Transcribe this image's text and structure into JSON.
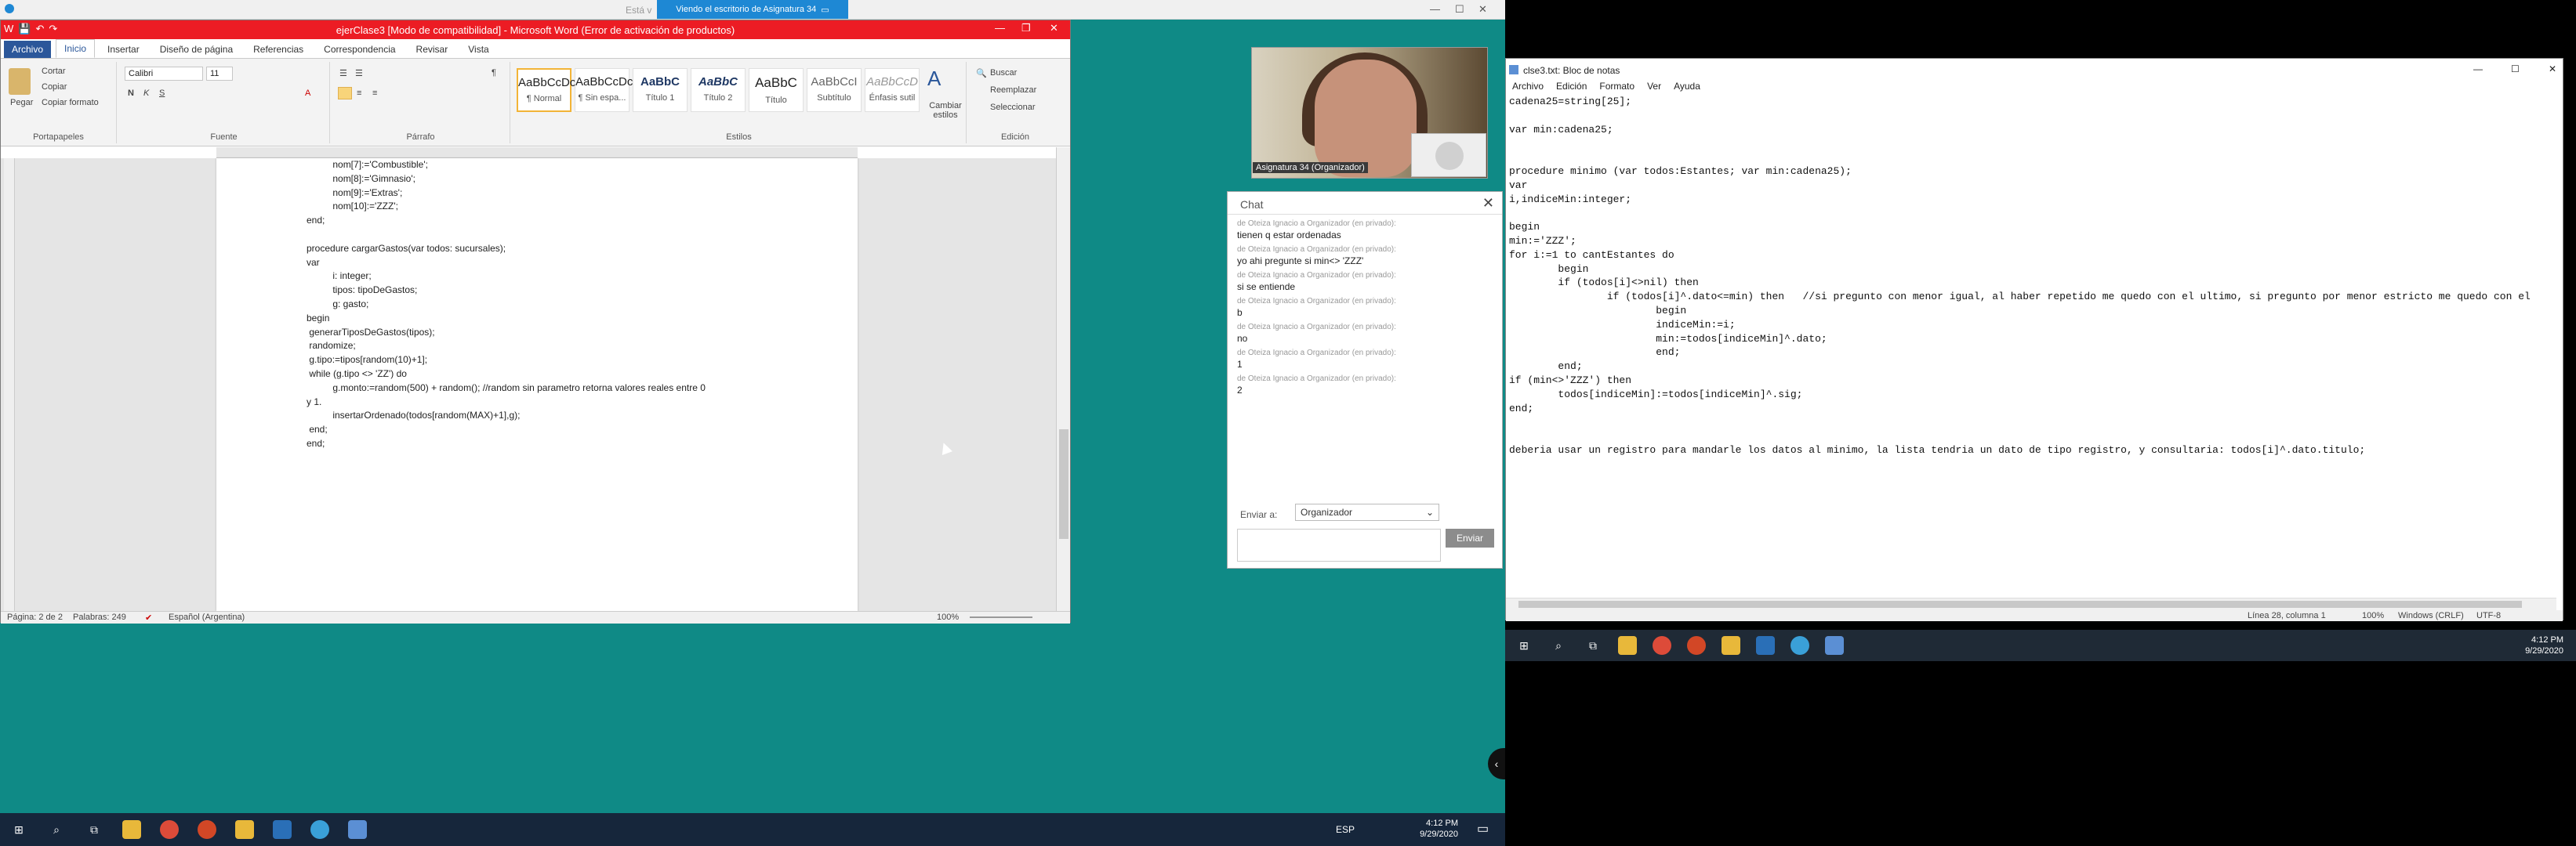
{
  "host": {
    "title_partial": "Está v",
    "share_banner": "Viendo el escritorio de Asignatura 34"
  },
  "word": {
    "title": "ejerClase3 [Modo de compatibilidad] - Microsoft Word (Error de activación de productos)",
    "tabs": [
      "Archivo",
      "Inicio",
      "Insertar",
      "Diseño de página",
      "Referencias",
      "Correspondencia",
      "Revisar",
      "Vista"
    ],
    "clipboard": {
      "paste": "Pegar",
      "cut": "Cortar",
      "copy": "Copiar",
      "format_painter": "Copiar formato",
      "label": "Portapapeles"
    },
    "font": {
      "name": "Calibri",
      "size": "11",
      "label": "Fuente"
    },
    "paragraph_label": "Párrafo",
    "styles": [
      {
        "preview": "AaBbCcDc",
        "name": "¶ Normal"
      },
      {
        "preview": "AaBbCcDc",
        "name": "¶ Sin espa..."
      },
      {
        "preview": "AaBbC",
        "name": "Título 1"
      },
      {
        "preview": "AaBbC",
        "name": "Título 2"
      },
      {
        "preview": "AaBbC",
        "name": "Título"
      },
      {
        "preview": "AaBbCcI",
        "name": "Subtítulo"
      },
      {
        "preview": "AaBbCcD",
        "name": "Énfasis sutil"
      }
    ],
    "styles_label": "Estilos",
    "change_styles": "Cambiar estilos",
    "editing": {
      "find": "Buscar",
      "replace": "Reemplazar",
      "select": "Seleccionar",
      "label": "Edición"
    },
    "doc_lines": [
      "          nom[7]:='Combustible';",
      "          nom[8]:='Gimnasio';",
      "          nom[9]:='Extras';",
      "          nom[10]:='ZZZ';",
      "end;",
      "",
      "procedure cargarGastos(var todos: sucursales);",
      "var",
      "          i: integer;",
      "          tipos: tipoDeGastos;",
      "          g: gasto;",
      "begin",
      " generarTiposDeGastos(tipos);",
      " randomize;",
      " g.tipo:=tipos[random(10)+1];",
      " while (g.tipo <> 'ZZ') do",
      "          g.monto:=random(500) + random(); //random sin parametro retorna valores reales entre 0",
      "y 1.",
      "          insertarOrdenado(todos[random(MAX)+1],g);",
      " end;",
      "end;"
    ],
    "status": {
      "page": "Página: 2 de 2",
      "words": "Palabras: 249",
      "language": "Español (Argentina)",
      "zoom": "100%"
    }
  },
  "video": {
    "name": "Asignatura 34 (Organizador)"
  },
  "chat": {
    "title": "Chat",
    "messages": [
      {
        "meta": "de Oteiza Ignacio a Organizador (en privado):",
        "text": "tienen q estar ordenadas"
      },
      {
        "meta": "de Oteiza Ignacio a Organizador (en privado):",
        "text": "yo ahi pregunte si min<> 'ZZZ'"
      },
      {
        "meta": "de Oteiza Ignacio a Organizador (en privado):",
        "text": "si se entiende"
      },
      {
        "meta": "de Oteiza Ignacio a Organizador (en privado):",
        "text": "b"
      },
      {
        "meta": "de Oteiza Ignacio a Organizador (en privado):",
        "text": "no"
      },
      {
        "meta": "de Oteiza Ignacio a Organizador (en privado):",
        "text": "1"
      },
      {
        "meta": "de Oteiza Ignacio a Organizador (en privado):",
        "text": "2"
      }
    ],
    "send_to_label": "Enviar a:",
    "send_to_value": "Organizador",
    "send_button": "Enviar"
  },
  "notepad": {
    "title": "clse3.txt: Bloc de notas",
    "menu": [
      "Archivo",
      "Edición",
      "Formato",
      "Ver",
      "Ayuda"
    ],
    "text": "cadena25=string[25];\n\nvar min:cadena25;\n\n\nprocedure minimo (var todos:Estantes; var min:cadena25);\nvar\ni,indiceMin:integer;\n\nbegin\nmin:='ZZZ';\nfor i:=1 to cantEstantes do\n        begin\n        if (todos[i]<>nil) then\n                if (todos[i]^.dato<=min) then   //si pregunto con menor igual, al haber repetido me quedo con el ultimo, si pregunto por menor estricto me quedo con el\n                        begin\n                        indiceMin:=i;\n                        min:=todos[indiceMin]^.dato;\n                        end;\n        end;\nif (min<>'ZZZ') then\n        todos[indiceMin]:=todos[indiceMin]^.sig;\nend;\n\n\ndeberia usar un registro para mandarle los datos al minimo, la lista tendria un dato de tipo registro, y consultaria: todos[i]^.dato.titulo;",
    "status": {
      "position": "Línea 28, columna 1",
      "zoom": "100%",
      "eol": "Windows (CRLF)",
      "encoding": "UTF-8"
    }
  },
  "taskbar_left": {
    "time": "4:12 PM",
    "date": "9/29/2020",
    "lang": "ESP"
  },
  "taskbar_right": {
    "time": "4:12 PM",
    "date": "9/29/2020"
  }
}
